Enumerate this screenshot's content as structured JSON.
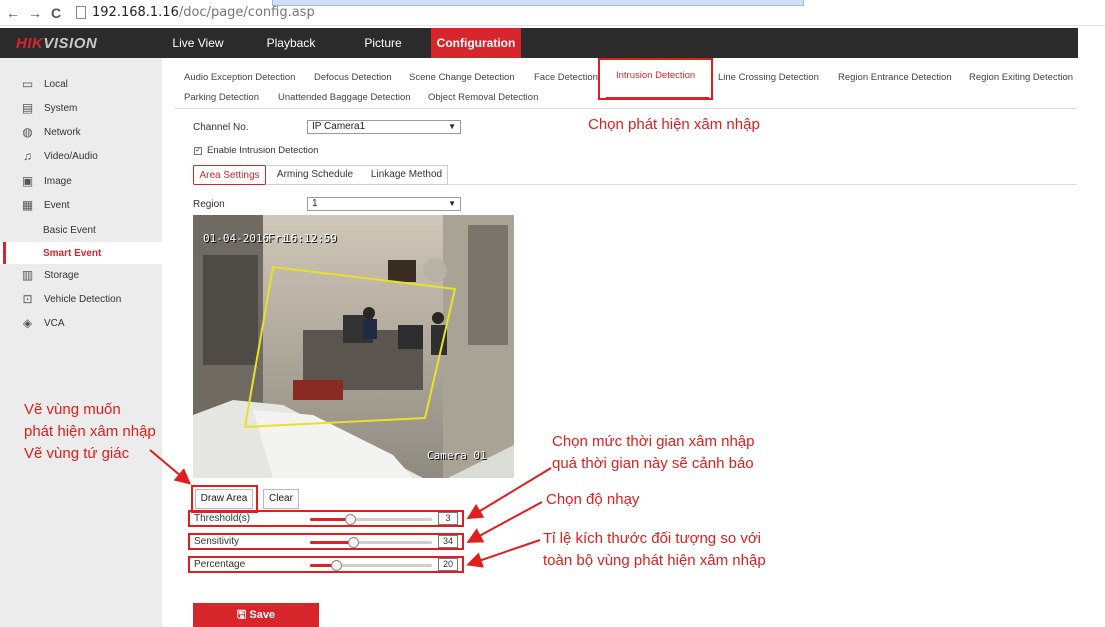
{
  "browser": {
    "back": "←",
    "forward": "→",
    "reload": "C",
    "url_host": "192.168.1.16",
    "url_path": "/doc/page/config.asp"
  },
  "header": {
    "logo_hik": "HIK",
    "logo_vision": "VISION",
    "nav": [
      "Live View",
      "Playback",
      "Picture",
      "Configuration"
    ],
    "active_color": "#d6262c"
  },
  "sidebar": {
    "items": [
      {
        "label": "Local",
        "icon": "monitor-icon"
      },
      {
        "label": "System",
        "icon": "system-icon"
      },
      {
        "label": "Network",
        "icon": "globe-icon"
      },
      {
        "label": "Video/Audio",
        "icon": "video-audio-icon"
      },
      {
        "label": "Image",
        "icon": "image-icon"
      },
      {
        "label": "Event",
        "icon": "calendar-icon"
      },
      {
        "label": "Storage",
        "icon": "storage-icon"
      },
      {
        "label": "Vehicle Detection",
        "icon": "vehicle-icon"
      },
      {
        "label": "VCA",
        "icon": "vca-icon"
      }
    ],
    "sub_items": [
      "Basic Event",
      "Smart Event"
    ]
  },
  "tabs": {
    "row1": [
      "Audio Exception Detection",
      "Defocus Detection",
      "Scene Change Detection",
      "Face Detection",
      "Intrusion Detection",
      "Line Crossing Detection",
      "Region Entrance Detection",
      "Region Exiting Detection"
    ],
    "row2": [
      "Parking Detection",
      "Unattended Baggage Detection",
      "Object Removal Detection"
    ]
  },
  "form": {
    "channel_label": "Channel No.",
    "channel_value": "IP Camera1",
    "enable_label": "Enable Intrusion Detection",
    "enable_checked": true,
    "subtabs": [
      "Area Settings",
      "Arming Schedule",
      "Linkage Method"
    ],
    "region_label": "Region",
    "region_value": "1"
  },
  "camera": {
    "osd_date": "01-04-2016",
    "osd_day": "Fri",
    "osd_time": "16:12:59",
    "osd_name": "Camera 01"
  },
  "buttons": {
    "draw_area": "Draw Area",
    "clear": "Clear",
    "save": "Save"
  },
  "sliders": [
    {
      "label": "Threshold(s)",
      "value": "3",
      "fraction": 0.33
    },
    {
      "label": "Sensitivity",
      "value": "34",
      "fraction": 0.36
    },
    {
      "label": "Percentage",
      "value": "20",
      "fraction": 0.22
    }
  ],
  "annotations": {
    "intrusion": "Chọn phát hiện xâm nhập",
    "draw_l1": "Vẽ vùng muốn",
    "draw_l2": "phát hiện xâm nhập",
    "draw_l3": "Vẽ vùng tứ giác",
    "threshold_l1": "Chọn mức thời gian xâm nhập",
    "threshold_l2": "quá thời gian này sẽ cảnh báo",
    "sensitivity": "Chọn độ nhạy",
    "percentage_l1": "Tỉ lệ kích thước đối tượng so với",
    "percentage_l2": "toàn bộ vùng phát hiện xâm nhập",
    "color": "#e11d1d"
  }
}
